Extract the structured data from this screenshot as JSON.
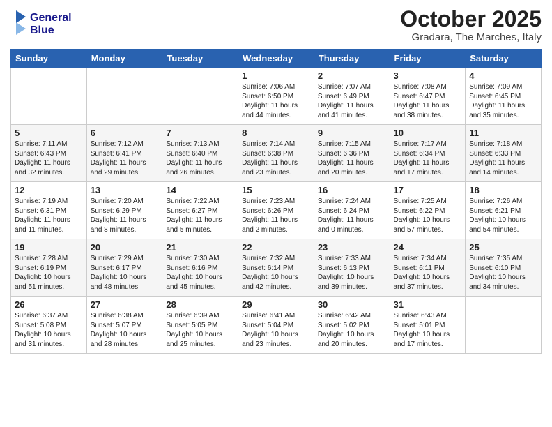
{
  "header": {
    "logo_line1": "General",
    "logo_line2": "Blue",
    "month": "October 2025",
    "location": "Gradara, The Marches, Italy"
  },
  "weekdays": [
    "Sunday",
    "Monday",
    "Tuesday",
    "Wednesday",
    "Thursday",
    "Friday",
    "Saturday"
  ],
  "weeks": [
    [
      {
        "day": "",
        "info": ""
      },
      {
        "day": "",
        "info": ""
      },
      {
        "day": "",
        "info": ""
      },
      {
        "day": "1",
        "info": "Sunrise: 7:06 AM\nSunset: 6:50 PM\nDaylight: 11 hours and 44 minutes."
      },
      {
        "day": "2",
        "info": "Sunrise: 7:07 AM\nSunset: 6:49 PM\nDaylight: 11 hours and 41 minutes."
      },
      {
        "day": "3",
        "info": "Sunrise: 7:08 AM\nSunset: 6:47 PM\nDaylight: 11 hours and 38 minutes."
      },
      {
        "day": "4",
        "info": "Sunrise: 7:09 AM\nSunset: 6:45 PM\nDaylight: 11 hours and 35 minutes."
      }
    ],
    [
      {
        "day": "5",
        "info": "Sunrise: 7:11 AM\nSunset: 6:43 PM\nDaylight: 11 hours and 32 minutes."
      },
      {
        "day": "6",
        "info": "Sunrise: 7:12 AM\nSunset: 6:41 PM\nDaylight: 11 hours and 29 minutes."
      },
      {
        "day": "7",
        "info": "Sunrise: 7:13 AM\nSunset: 6:40 PM\nDaylight: 11 hours and 26 minutes."
      },
      {
        "day": "8",
        "info": "Sunrise: 7:14 AM\nSunset: 6:38 PM\nDaylight: 11 hours and 23 minutes."
      },
      {
        "day": "9",
        "info": "Sunrise: 7:15 AM\nSunset: 6:36 PM\nDaylight: 11 hours and 20 minutes."
      },
      {
        "day": "10",
        "info": "Sunrise: 7:17 AM\nSunset: 6:34 PM\nDaylight: 11 hours and 17 minutes."
      },
      {
        "day": "11",
        "info": "Sunrise: 7:18 AM\nSunset: 6:33 PM\nDaylight: 11 hours and 14 minutes."
      }
    ],
    [
      {
        "day": "12",
        "info": "Sunrise: 7:19 AM\nSunset: 6:31 PM\nDaylight: 11 hours and 11 minutes."
      },
      {
        "day": "13",
        "info": "Sunrise: 7:20 AM\nSunset: 6:29 PM\nDaylight: 11 hours and 8 minutes."
      },
      {
        "day": "14",
        "info": "Sunrise: 7:22 AM\nSunset: 6:27 PM\nDaylight: 11 hours and 5 minutes."
      },
      {
        "day": "15",
        "info": "Sunrise: 7:23 AM\nSunset: 6:26 PM\nDaylight: 11 hours and 2 minutes."
      },
      {
        "day": "16",
        "info": "Sunrise: 7:24 AM\nSunset: 6:24 PM\nDaylight: 11 hours and 0 minutes."
      },
      {
        "day": "17",
        "info": "Sunrise: 7:25 AM\nSunset: 6:22 PM\nDaylight: 10 hours and 57 minutes."
      },
      {
        "day": "18",
        "info": "Sunrise: 7:26 AM\nSunset: 6:21 PM\nDaylight: 10 hours and 54 minutes."
      }
    ],
    [
      {
        "day": "19",
        "info": "Sunrise: 7:28 AM\nSunset: 6:19 PM\nDaylight: 10 hours and 51 minutes."
      },
      {
        "day": "20",
        "info": "Sunrise: 7:29 AM\nSunset: 6:17 PM\nDaylight: 10 hours and 48 minutes."
      },
      {
        "day": "21",
        "info": "Sunrise: 7:30 AM\nSunset: 6:16 PM\nDaylight: 10 hours and 45 minutes."
      },
      {
        "day": "22",
        "info": "Sunrise: 7:32 AM\nSunset: 6:14 PM\nDaylight: 10 hours and 42 minutes."
      },
      {
        "day": "23",
        "info": "Sunrise: 7:33 AM\nSunset: 6:13 PM\nDaylight: 10 hours and 39 minutes."
      },
      {
        "day": "24",
        "info": "Sunrise: 7:34 AM\nSunset: 6:11 PM\nDaylight: 10 hours and 37 minutes."
      },
      {
        "day": "25",
        "info": "Sunrise: 7:35 AM\nSunset: 6:10 PM\nDaylight: 10 hours and 34 minutes."
      }
    ],
    [
      {
        "day": "26",
        "info": "Sunrise: 6:37 AM\nSunset: 5:08 PM\nDaylight: 10 hours and 31 minutes."
      },
      {
        "day": "27",
        "info": "Sunrise: 6:38 AM\nSunset: 5:07 PM\nDaylight: 10 hours and 28 minutes."
      },
      {
        "day": "28",
        "info": "Sunrise: 6:39 AM\nSunset: 5:05 PM\nDaylight: 10 hours and 25 minutes."
      },
      {
        "day": "29",
        "info": "Sunrise: 6:41 AM\nSunset: 5:04 PM\nDaylight: 10 hours and 23 minutes."
      },
      {
        "day": "30",
        "info": "Sunrise: 6:42 AM\nSunset: 5:02 PM\nDaylight: 10 hours and 20 minutes."
      },
      {
        "day": "31",
        "info": "Sunrise: 6:43 AM\nSunset: 5:01 PM\nDaylight: 10 hours and 17 minutes."
      },
      {
        "day": "",
        "info": ""
      }
    ]
  ]
}
